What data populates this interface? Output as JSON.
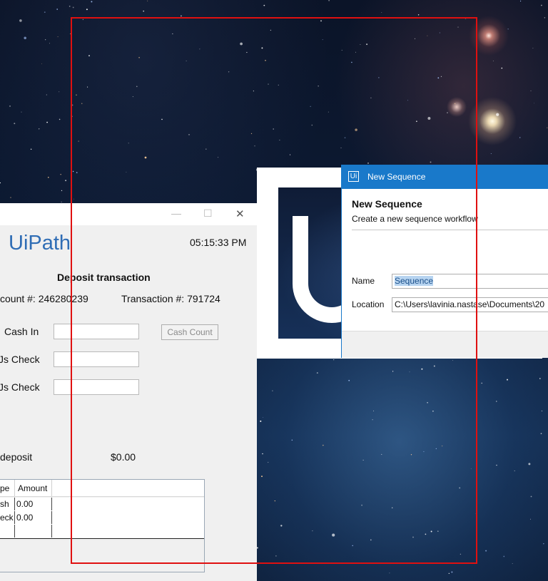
{
  "deposit_app": {
    "logo": "UiPath",
    "time": "05:15:33 PM",
    "heading": "Deposit transaction",
    "account": "count #: 246280239",
    "transaction": "Transaction #: 791724",
    "cash_in_label": "Cash In",
    "check1_label": "Js Check",
    "check2_label": "Js Check",
    "cash_count_button": "Cash Count",
    "total_label": "deposit",
    "total_value": "$0.00",
    "grid": {
      "columns": [
        "pe",
        "Amount"
      ],
      "rows": [
        {
          "type": "sh",
          "amount": "0.00"
        },
        {
          "type": "eck",
          "amount": "0.00"
        },
        {
          "type": "",
          "amount": ""
        }
      ]
    }
  },
  "dialog": {
    "title": "New Sequence",
    "header": "New Sequence",
    "subtitle": "Create a new sequence workflow",
    "name_label": "Name",
    "name_value": "Sequence",
    "location_label": "Location",
    "location_value": "C:\\Users\\lavinia.nastase\\Documents\\20"
  },
  "colors": {
    "accent": "#1979ca",
    "logo_blue": "#2f6db5",
    "highlight_rect": "#e01010"
  }
}
